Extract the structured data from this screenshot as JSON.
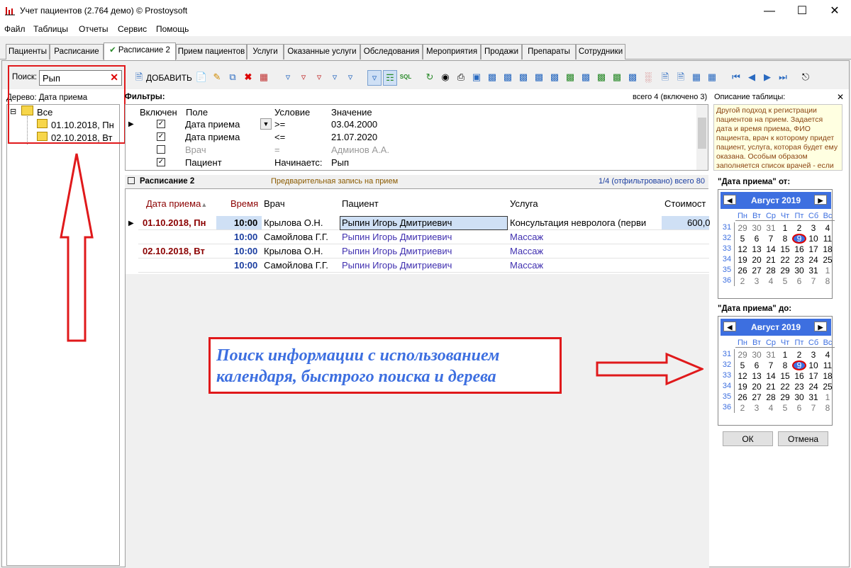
{
  "window": {
    "title": "Учет пациентов (2.764 демо) © Prostoysoft"
  },
  "menu": [
    "Файл",
    "Таблицы",
    "Отчеты",
    "Сервис",
    "Помощь"
  ],
  "tabs": [
    "Пациенты",
    "Расписание",
    "Расписание 2",
    "Прием пациентов",
    "Услуги",
    "Оказанные услуги",
    "Обследования",
    "Мероприятия",
    "Продажи",
    "Препараты",
    "Сотрудники"
  ],
  "search": {
    "label": "Поиск:",
    "value": "Рып"
  },
  "toolbar": {
    "add_label": "ДОБАВИТЬ"
  },
  "tree": {
    "title": "Дерево: Дата приема",
    "root": "Все",
    "items": [
      "01.10.2018, Пн",
      "02.10.2018, Вт"
    ]
  },
  "filters": {
    "title": "Фильтры:",
    "summary": "всего 4 (включено 3)",
    "headers": [
      "Включен",
      "Поле",
      "Условие",
      "Значение"
    ],
    "rows": [
      {
        "enabled": true,
        "field": "Дата приема",
        "cond": ">=",
        "value": "03.04.2000"
      },
      {
        "enabled": true,
        "field": "Дата приема",
        "cond": "<=",
        "value": "21.07.2020"
      },
      {
        "enabled": false,
        "field": "Врач",
        "cond": "=",
        "value": "Админов А.А."
      },
      {
        "enabled": true,
        "field": "Пациент",
        "cond": "Начинаетс:",
        "value": "Рып"
      }
    ]
  },
  "schedule": {
    "title": "Расписание 2",
    "subtitle": "Предварительная запись на прием",
    "count": "1/4 (отфильтровано) всего 80",
    "headers": [
      "Дата приема",
      "Время",
      "Врач",
      "Пациент",
      "Услуга",
      "Стоимост"
    ],
    "rows": [
      {
        "date": "01.10.2018, Пн",
        "time": "10:00",
        "doctor": "Крылова О.Н.",
        "patient": "Рыпин Игорь Дмитриевич",
        "service": "Консультация невролога (перви",
        "cost": "600,0"
      },
      {
        "date": "",
        "time": "10:00",
        "doctor": "Самойлова Г.Г.",
        "patient": "Рыпин Игорь Дмитриевич",
        "service": "Массаж",
        "cost": ""
      },
      {
        "date": "02.10.2018, Вт",
        "time": "10:00",
        "doctor": "Крылова О.Н.",
        "patient": "Рыпин Игорь Дмитриевич",
        "service": "Массаж",
        "cost": ""
      },
      {
        "date": "",
        "time": "10:00",
        "doctor": "Самойлова Г.Г.",
        "patient": "Рыпин Игорь Дмитриевич",
        "service": "Массаж",
        "cost": ""
      }
    ]
  },
  "description": {
    "title": "Описание таблицы:",
    "text": "Другой подход к регистрации пациентов на прием. Задается дата и время приема, ФИО пациента, врач к которому придет пациент, услуга, которая будет ему оказана. Особым образом заполняется список врачей - если"
  },
  "calendar_from": {
    "label": "\"Дата приема\" от:",
    "month": "Август 2019"
  },
  "calendar_to": {
    "label": "\"Дата приема\" до:",
    "month": "Август 2019"
  },
  "weekdays": [
    "Пн",
    "Вт",
    "Ср",
    "Чт",
    "Пт",
    "Сб",
    "Вс"
  ],
  "weeks": [
    "31",
    "32",
    "33",
    "34",
    "35",
    "36"
  ],
  "days": [
    [
      "29",
      "30",
      "31",
      "1",
      "2",
      "3",
      "4"
    ],
    [
      "5",
      "6",
      "7",
      "8",
      "9",
      "10",
      "11"
    ],
    [
      "12",
      "13",
      "14",
      "15",
      "16",
      "17",
      "18"
    ],
    [
      "19",
      "20",
      "21",
      "22",
      "23",
      "24",
      "25"
    ],
    [
      "26",
      "27",
      "28",
      "29",
      "30",
      "31",
      "1"
    ],
    [
      "2",
      "3",
      "4",
      "5",
      "6",
      "7",
      "8"
    ]
  ],
  "buttons": {
    "ok": "ОК",
    "cancel": "Отмена"
  },
  "annotation": "Поиск информации с использованием календаря, быстрого поиска и дерева",
  "colors": {
    "accent": "#3d6fe0",
    "red": "#e0191b",
    "date": "#8b0000"
  }
}
